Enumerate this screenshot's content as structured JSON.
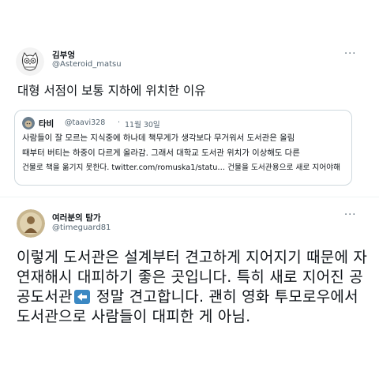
{
  "tweet1": {
    "display_name": "김부엉",
    "handle": "@Asteroid_matsu",
    "text": "대형 서점이 보통 지하에 위치한 이유",
    "more": "···"
  },
  "quote": {
    "display_name": "타비",
    "handle": "@taavi328",
    "separator": "·",
    "date": "11월 30일",
    "lines": [
      "사람들이 잘 모르는 지식중에 하나데 책무게가 생각보다 무거워서 도서관은 올림",
      "때부터 버티는 하중이 다르게 올라감. 그래서 대학교 도서관 위치가 이상해도 다른",
      "건물로 책을 옮기지 못한다. twitter.com/romuska1/statu… 건물을 도서관용으로 새로 지어야해"
    ]
  },
  "tweet2": {
    "display_name": "여러분의 탐가",
    "handle": "@timeguard81",
    "more": "···",
    "lines": [
      "이렇게 도서관은 설계부터 견고하게 지어지기 때문에 자",
      "연재해시 대피하기 좋은 곳입니다. 특히 새로 지어진 공",
      "정말 견고합니다. 괜히 영화 투모로우에서",
      "도서관으로 사람들이 대피한 게 아님."
    ],
    "line3_prefix": "공도서관",
    "emoji": "left-arrow-icon",
    "emoji_color": "#3b88c3"
  }
}
